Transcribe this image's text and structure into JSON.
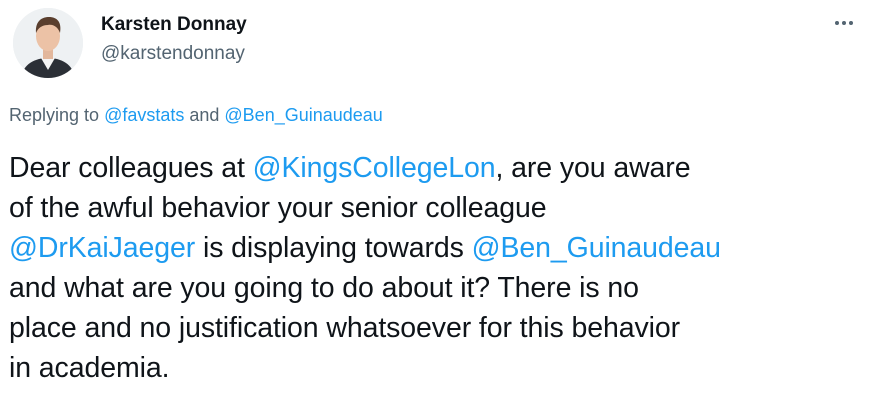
{
  "author": {
    "display_name": "Karsten Donnay",
    "handle": "@karstendonnay",
    "avatar_icon": "profile-photo"
  },
  "more_icon": "ellipsis-icon",
  "reply": {
    "prefix": "Replying to ",
    "mention_1": "@favstats",
    "joiner": " and ",
    "mention_2": "@Ben_Guinaudeau"
  },
  "body": {
    "l1_a": "Dear colleagues at ",
    "l1_mention": "@KingsCollegeLon",
    "l1_b": ", are you aware",
    "l2": "of the awful behavior your senior colleague",
    "l3_mention": "@DrKaiJaeger",
    "l3_a": " is displaying towards ",
    "l3_mention_2": "@Ben_Guinaudeau",
    "l4": "and what are you going to do about it? There is no",
    "l5": "place and no justification whatsoever for this behavior",
    "l6": "in academia."
  },
  "colors": {
    "link": "#1d9bf0",
    "text": "#0f1419",
    "secondary": "#536471"
  }
}
